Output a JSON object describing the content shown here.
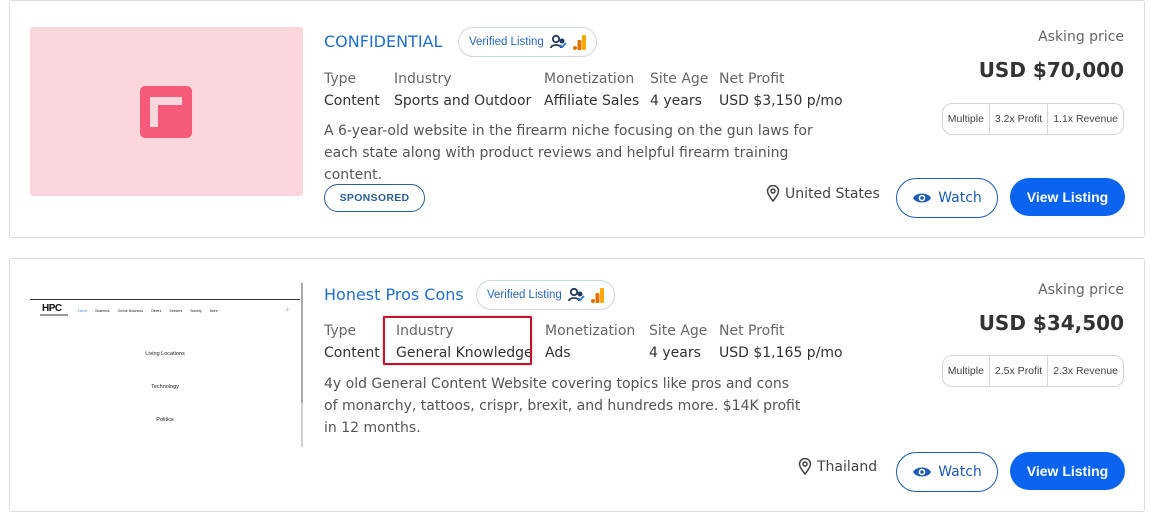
{
  "listings": [
    {
      "title": "CONFIDENTIAL",
      "verified_label": "Verified Listing",
      "attributes": [
        {
          "label": "Type",
          "value": "Content"
        },
        {
          "label": "Industry",
          "value": "Sports and Outdoor"
        },
        {
          "label": "Monetization",
          "value": "Affiliate Sales"
        },
        {
          "label": "Site Age",
          "value": "4 years"
        },
        {
          "label": "Net Profit",
          "value": "USD $3,150 p/mo"
        }
      ],
      "description": "A 6-year-old website in the firearm niche focusing on the gun laws for each state along with product reviews and helpful firearm training content.",
      "badge": "SPONSORED",
      "location": "United States",
      "price_label": "Asking price",
      "price": "USD $70,000",
      "multiples": [
        "Multiple",
        "3.2x Profit",
        "1.1x Revenue"
      ],
      "watch_label": "Watch",
      "view_label": "View Listing",
      "thumb_icon": "placeholder-logo-icon"
    },
    {
      "title": "Honest Pros Cons",
      "verified_label": "Verified Listing",
      "attributes": [
        {
          "label": "Type",
          "value": "Content"
        },
        {
          "label": "Industry",
          "value": "General Knowledge"
        },
        {
          "label": "Monetization",
          "value": "Ads"
        },
        {
          "label": "Site Age",
          "value": "4 years"
        },
        {
          "label": "Net Profit",
          "value": "USD $1,165 p/mo"
        }
      ],
      "description": "4y old General Content Website covering topics like pros and cons of monarchy, tattoos, crispr, brexit, and hundreds more. $14K profit in 12 months.",
      "location": "Thailand",
      "price_label": "Asking price",
      "price": "USD $34,500",
      "multiples": [
        "Multiple",
        "2.5x Profit",
        "2.3x Revenue"
      ],
      "watch_label": "Watch",
      "view_label": "View Listing",
      "thumb_site": {
        "logo": "HPC",
        "nav": [
          "Home",
          "Business",
          "Online Business",
          "Others",
          "Seekers",
          "Society",
          "More"
        ],
        "items": [
          "Living Locations",
          "Technology",
          "Politics"
        ]
      }
    }
  ],
  "colors": {
    "accent": "#0a64f0",
    "title": "#1f6fd1",
    "highlight": "#c8102e",
    "thumb_pink": "#fcd6dd",
    "logo_pink": "#f55a78"
  }
}
